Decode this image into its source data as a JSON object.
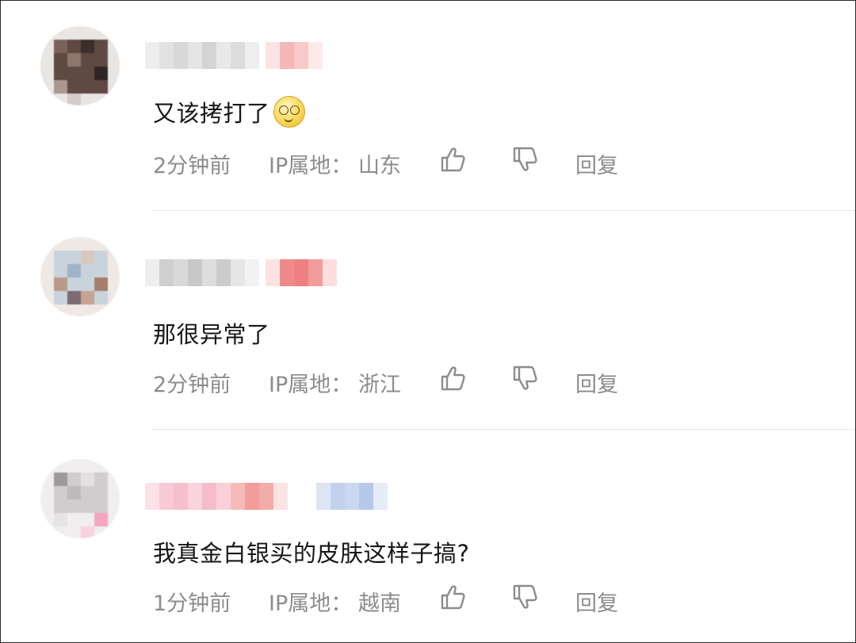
{
  "comments": [
    {
      "text": "又该拷打了",
      "emoji": "smiling-face-emoji",
      "time": "2分钟前",
      "ip_label": "IP属地：",
      "ip_value": "山东",
      "reply_label": "回复"
    },
    {
      "text": "那很异常了",
      "time": "2分钟前",
      "ip_label": "IP属地：",
      "ip_value": "浙江",
      "reply_label": "回复"
    },
    {
      "text": "我真金白银买的皮肤这样子搞?",
      "time": "1分钟前",
      "ip_label": "IP属地：",
      "ip_value": "越南",
      "reply_label": "回复"
    }
  ],
  "icons": {
    "like": "thumbs-up-icon",
    "dislike": "thumbs-down-icon"
  },
  "colors": {
    "meta_text": "#8c8c8c",
    "divider": "#e6e6e6"
  }
}
